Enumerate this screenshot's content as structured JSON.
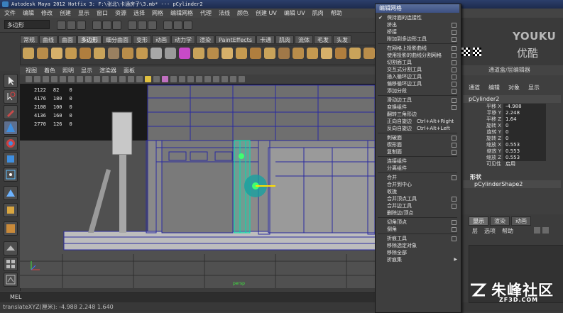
{
  "window": {
    "title": "Autodesk Maya 2012 Hotfix 3: F:\\张北\\卡通房子\\3.mb*   ---   pCylinder2"
  },
  "menubar": [
    "文件",
    "编辑",
    "修改",
    "创建",
    "显示",
    "窗口",
    "资源",
    "选择",
    "网格",
    "编辑网格",
    "代理",
    "法线",
    "颜色",
    "创建 UV",
    "编辑 UV",
    "肌肉",
    "帮助"
  ],
  "status": {
    "mode": "多边形"
  },
  "shelf": {
    "tabs": [
      "常规",
      "曲线",
      "曲面",
      "多边形",
      "细分曲面",
      "变形",
      "动画",
      "动力学",
      "渲染",
      "PaintEffects",
      "卡通",
      "肌肉",
      "流体",
      "毛发",
      "头发"
    ],
    "active_tab": "多边形"
  },
  "panel": {
    "menus": [
      "视图",
      "着色",
      "照明",
      "显示",
      "渲染器",
      "面板"
    ]
  },
  "hud": {
    "rows": [
      [
        "",
        "2122",
        "82",
        "0"
      ],
      [
        "",
        "4176",
        "180",
        "0"
      ],
      [
        "",
        "2108",
        "100",
        "0"
      ],
      [
        "",
        "4136",
        "160",
        "0"
      ],
      [
        "",
        "2770",
        "126",
        "0"
      ]
    ],
    "camera": "persp"
  },
  "context_menu": {
    "title": "编辑网格",
    "items": [
      {
        "label": "保持面的连接性",
        "check": true
      },
      {
        "label": "挤出",
        "option": true
      },
      {
        "label": "桥接",
        "option": true
      },
      {
        "label": "附加到多边形工具",
        "option": true
      },
      {
        "sep": true
      },
      {
        "label": "在网格上投影曲线",
        "option": true
      },
      {
        "label": "使用投影的曲线分割网格",
        "option": true
      },
      {
        "label": "切割面工具",
        "option": true
      },
      {
        "label": "交互式分割工具",
        "option": true
      },
      {
        "label": "插入循环边工具",
        "option": true
      },
      {
        "label": "偏移循环边工具",
        "option": true
      },
      {
        "label": "添加分段",
        "option": true
      },
      {
        "sep": true
      },
      {
        "label": "滑动边工具",
        "option": true
      },
      {
        "label": "变换组件",
        "option": true
      },
      {
        "label": "翻转三角形边"
      },
      {
        "label": "正向自旋边",
        "shortcut": "Ctrl+Alt+Right"
      },
      {
        "label": "反向自旋边",
        "shortcut": "Ctrl+Alt+Left"
      },
      {
        "sep": true
      },
      {
        "label": "刺破面",
        "option": true
      },
      {
        "label": "楔形面",
        "option": true
      },
      {
        "label": "复制面",
        "option": true
      },
      {
        "sep": true
      },
      {
        "label": "连接组件"
      },
      {
        "label": "分离组件"
      },
      {
        "sep": true
      },
      {
        "label": "合并",
        "option": true
      },
      {
        "label": "合并到中心"
      },
      {
        "label": "收拢"
      },
      {
        "label": "合并顶点工具",
        "option": true
      },
      {
        "label": "合并边工具",
        "option": true
      },
      {
        "label": "删除边/顶点"
      },
      {
        "sep": true
      },
      {
        "label": "切角顶点",
        "option": true
      },
      {
        "label": "倒角",
        "option": true
      },
      {
        "sep": true
      },
      {
        "label": "折痕工具",
        "option": true
      },
      {
        "label": "移除选定对象"
      },
      {
        "label": "移除全部"
      },
      {
        "label": "折痕集",
        "submenu": true
      }
    ]
  },
  "watermark_top": {
    "en": "YOUKU",
    "cn": "优酷"
  },
  "channel_box": {
    "title": "通道盒/层编辑器",
    "menus": [
      "通道",
      "编辑",
      "对象",
      "显示"
    ],
    "object": "pCylinder2",
    "attributes": [
      {
        "label": "平移 X",
        "value": "-4.988"
      },
      {
        "label": "平移 Y",
        "value": "2.248"
      },
      {
        "label": "平移 Z",
        "value": "1.64"
      },
      {
        "label": "旋转 X",
        "value": "0"
      },
      {
        "label": "旋转 Y",
        "value": "0"
      },
      {
        "label": "旋转 Z",
        "value": "0"
      },
      {
        "label": "缩放 X",
        "value": "0.553"
      },
      {
        "label": "缩放 Y",
        "value": "0.553"
      },
      {
        "label": "缩放 Z",
        "value": "0.553"
      },
      {
        "label": "可见性",
        "value": "启用"
      }
    ],
    "shapes_header": "形状",
    "shape_name": "pCylinderShape2"
  },
  "layer_editor": {
    "tabs": [
      "显示",
      "渲染",
      "动画"
    ],
    "active_tab": "显示",
    "menus": [
      "层",
      "选项",
      "帮助"
    ]
  },
  "command_line": {
    "label": "MEL"
  },
  "help_line": {
    "text": "translateXYZ(厘米):   -4.988    2.248    1.640"
  },
  "watermark_bottom": {
    "cn": "朱峰社区",
    "en": "ZF3D.COM"
  },
  "colors": {
    "title_bar": "#2c3f6b",
    "selection": "#00d0b0",
    "menu_title": "#4a5f8f"
  }
}
